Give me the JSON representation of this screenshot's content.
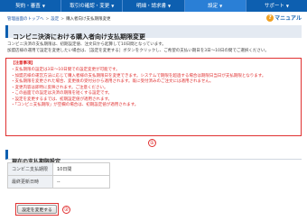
{
  "nav": {
    "tabs": [
      {
        "label": "契約・審査",
        "active": false
      },
      {
        "label": "取引の確認・変更",
        "active": false
      },
      {
        "label": "明細・請求書",
        "active": false
      },
      {
        "label": "設定",
        "active": true
      },
      {
        "label": "サポート",
        "active": false
      }
    ]
  },
  "breadcrumb": {
    "items": [
      "管理画面のトップへ",
      "設定",
      "購入者向け支払期限変更"
    ]
  },
  "manual_label": "マニュアル",
  "page_title": "コンビニ決済における購入者向け支払期限変更",
  "intro": {
    "line1": "コンビニ決済の支払期限は、初期設定値、注文日から起算して10日間となっています。",
    "line2": "加盟店様の運用で設定を変更したい場合は、［設定を変更する］ボタンをクリックし、ご希望の支払い期日を3日〜10日の間でご選択ください。"
  },
  "notice": {
    "heading": "【注意事項】",
    "lines": [
      "・支払期限の設定は3日〜10日間での設定変更が可能です。",
      "・加盟店様の運営方法に応じて購入者様の支払期限日を変更できます。システムで期限を超過する場合は期限日当日が支払期限となります。",
      "・支払期限を変更された場合、変更後の受付分から適用されます。既に受付済みのご注文には適用されません。",
      "・変更内容は即時に反映されます。ご注意ください。",
      "・この画面での設定は決済の期限を短くする設定です。",
      "・設定を変更するまでは、初期設定値が適用されます。",
      "・「コンビニ支払期限」が空欄の場合は、初期設定値が適用されます。"
    ]
  },
  "marker1": "①",
  "marker2": "②",
  "current_section_title": "現在の支払期限設定",
  "settings": {
    "rows": [
      {
        "key": "コンビニ支払期限",
        "value": "10日間"
      },
      {
        "key": "最終更新日時",
        "value": "--"
      }
    ]
  },
  "change_button_label": "設定を変更する"
}
